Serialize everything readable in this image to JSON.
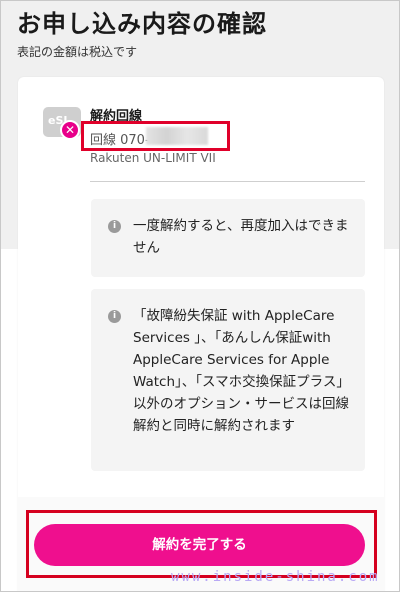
{
  "header": {
    "title": "お申し込み内容の確認",
    "subtitle": "表記の金額は税込です"
  },
  "line": {
    "badge_text": "eSI",
    "label": "解約回線",
    "number_prefix": "回線 070-",
    "plan": "Rakuten UN-LIMIT VII"
  },
  "notices": [
    {
      "text": "一度解約すると、再度加入はできません"
    },
    {
      "text": "「故障紛失保証 with AppleCare Services 」、「あんしん保証with AppleCare Services for Apple Watch」、「スマホ交換保証プラス」 以外のオプション・サービスは回線解約と同時に解約されます"
    }
  ],
  "actions": {
    "complete_label": "解約を完了する"
  },
  "watermark": "www.inside-shina.com",
  "colors": {
    "accent": "#ef0f8e",
    "highlight_frame": "#d5001f",
    "cancel_mark": "#e8008a"
  },
  "icons": {
    "info": "info-icon",
    "cancel": "close-icon"
  }
}
